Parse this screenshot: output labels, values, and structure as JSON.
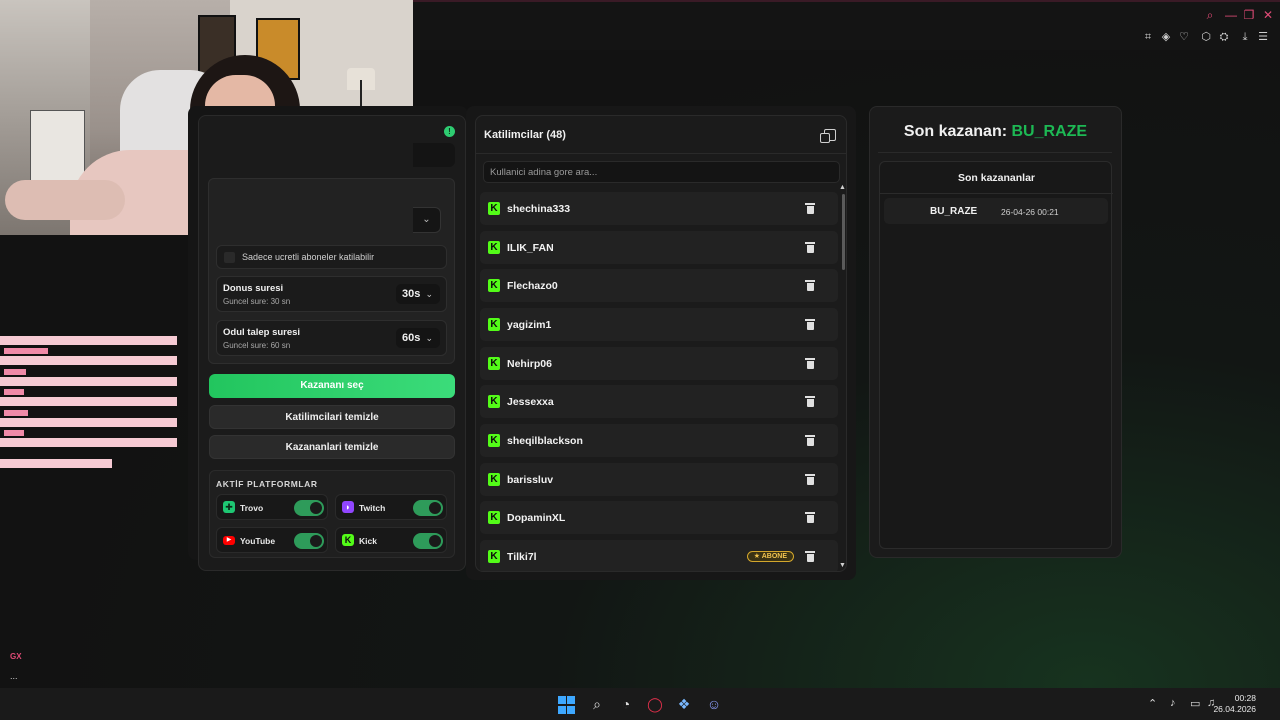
{
  "browser": {
    "window_controls": [
      "search-icon",
      "minimize-icon",
      "restore-icon",
      "close-icon"
    ],
    "toolbar_icons": [
      "snapshot-icon",
      "pocket-icon",
      "heart-icon",
      "extensions-icon",
      "account-icon",
      "download-icon",
      "menu-icon"
    ]
  },
  "sidebar": {
    "gx_label": "GX",
    "more_label": "..."
  },
  "left_panel": {
    "status_badge": "!",
    "checkbox_label": "Sadece ucretli aboneler katilabilir",
    "settings": [
      {
        "title": "Donus suresi",
        "subtitle": "Guncel sure: 30 sn",
        "value": "30s"
      },
      {
        "title": "Odul talep suresi",
        "subtitle": "Guncel sure: 60 sn",
        "value": "60s"
      }
    ],
    "buttons": {
      "pick_winner": "Kazananı seç",
      "clear_participants": "Katilimcilari temizle",
      "clear_winners": "Kazananlari temizle"
    },
    "platforms": {
      "heading": "AKTİF PLATFORMLAR",
      "items": [
        {
          "name": "Trovo",
          "enabled": true,
          "color": "#1ec773"
        },
        {
          "name": "Twitch",
          "enabled": true,
          "color": "#9146ff"
        },
        {
          "name": "YouTube",
          "enabled": true,
          "color": "#ff0000"
        },
        {
          "name": "Kick",
          "enabled": true,
          "color": "#53fc18"
        }
      ]
    }
  },
  "participants": {
    "title": "Katilimcilar (48)",
    "search_placeholder": "Kullanici adina gore ara...",
    "rows": [
      {
        "name": "shechina333",
        "badge": ""
      },
      {
        "name": "ILIK_FAN",
        "badge": ""
      },
      {
        "name": "Flechazo0",
        "badge": ""
      },
      {
        "name": "yagizim1",
        "badge": ""
      },
      {
        "name": "Nehirp06",
        "badge": ""
      },
      {
        "name": "Jessexxa",
        "badge": ""
      },
      {
        "name": "sheqilblackson",
        "badge": ""
      },
      {
        "name": "barissluv",
        "badge": ""
      },
      {
        "name": "DopaminXL",
        "badge": ""
      },
      {
        "name": "Tilki7l",
        "badge": "★ ABONE"
      }
    ]
  },
  "winner_panel": {
    "heading_prefix": "Son kazanan: ",
    "heading_name": "BU_RAZE",
    "list_title": "Son kazananlar",
    "rows": [
      {
        "name": "BU_RAZE",
        "date": "26-04-26 00:21"
      }
    ]
  },
  "taskbar": {
    "time": "00:28",
    "date": "26.04.2026"
  },
  "colors": {
    "accent_green": "#22c55e",
    "kick_green": "#53fc18",
    "winner_green": "#1db954",
    "browser_accent": "#e04b76"
  }
}
